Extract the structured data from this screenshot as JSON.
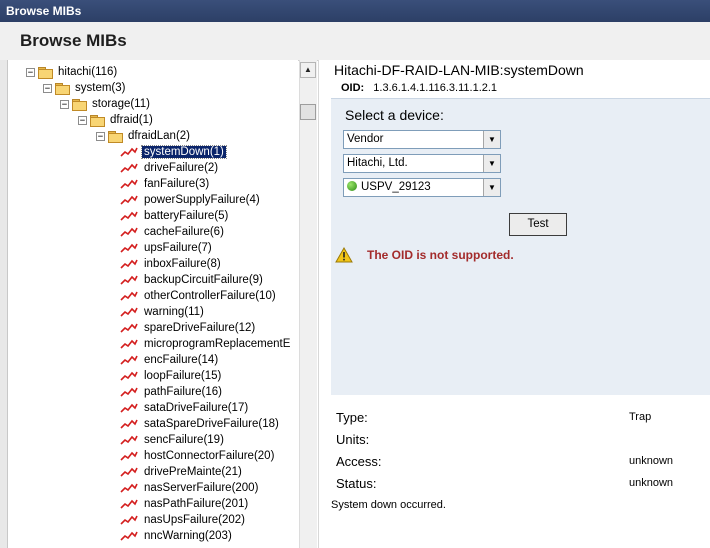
{
  "window": {
    "title": "Browse MIBs"
  },
  "header": {
    "title": "Browse MIBs"
  },
  "tree": {
    "nodes": [
      {
        "label": "hitachi(116)",
        "kind": "folder",
        "expander": "−"
      },
      {
        "label": "system(3)",
        "kind": "folder",
        "expander": "−"
      },
      {
        "label": "storage(11)",
        "kind": "folder",
        "expander": "−"
      },
      {
        "label": "dfraid(1)",
        "kind": "folder",
        "expander": "−"
      },
      {
        "label": "dfraidLan(2)",
        "kind": "folder",
        "expander": "−"
      },
      {
        "label": "systemDown(1)",
        "kind": "trap",
        "selected": true
      },
      {
        "label": "driveFailure(2)",
        "kind": "trap"
      },
      {
        "label": "fanFailure(3)",
        "kind": "trap"
      },
      {
        "label": "powerSupplyFailure(4)",
        "kind": "trap"
      },
      {
        "label": "batteryFailure(5)",
        "kind": "trap"
      },
      {
        "label": "cacheFailure(6)",
        "kind": "trap"
      },
      {
        "label": "upsFailure(7)",
        "kind": "trap"
      },
      {
        "label": "inboxFailure(8)",
        "kind": "trap"
      },
      {
        "label": "backupCircuitFailure(9)",
        "kind": "trap"
      },
      {
        "label": "otherControllerFailure(10)",
        "kind": "trap"
      },
      {
        "label": "warning(11)",
        "kind": "trap"
      },
      {
        "label": "spareDriveFailure(12)",
        "kind": "trap"
      },
      {
        "label": "microprogramReplacementE",
        "kind": "trap"
      },
      {
        "label": "encFailure(14)",
        "kind": "trap"
      },
      {
        "label": "loopFailure(15)",
        "kind": "trap"
      },
      {
        "label": "pathFailure(16)",
        "kind": "trap"
      },
      {
        "label": "sataDriveFailure(17)",
        "kind": "trap"
      },
      {
        "label": "sataSpareDriveFailure(18)",
        "kind": "trap"
      },
      {
        "label": "sencFailure(19)",
        "kind": "trap"
      },
      {
        "label": "hostConnectorFailure(20)",
        "kind": "trap"
      },
      {
        "label": "drivePreMainte(21)",
        "kind": "trap"
      },
      {
        "label": "nasServerFailure(200)",
        "kind": "trap"
      },
      {
        "label": "nasPathFailure(201)",
        "kind": "trap"
      },
      {
        "label": "nasUpsFailure(202)",
        "kind": "trap"
      },
      {
        "label": "nncWarning(203)",
        "kind": "trap"
      }
    ]
  },
  "detail": {
    "mib_name": "Hitachi-DF-RAID-LAN-MIB:systemDown",
    "oid_label": "OID:",
    "oid_value": "1.3.6.1.4.1.116.3.11.1.2.1",
    "select_title": "Select a device:",
    "device_type": "Vendor",
    "vendor": "Hitachi, Ltd.",
    "device": "USPV_29123",
    "device_status_color": "#3aa81c",
    "test_label": "Test",
    "warning": "The OID is not supported.",
    "warning_color": "#a32b2b"
  },
  "properties": {
    "type_label": "Type:",
    "type_value": "Trap",
    "units_label": "Units:",
    "access_label": "Access:",
    "access_value": "unknown",
    "status_label": "Status:",
    "status_value": "unknown",
    "description": "System down occurred."
  },
  "icons": {
    "folder": "folder-icon",
    "trap": "trap-icon",
    "warning": "warning-icon"
  },
  "colors": {
    "selection": "#0a246a",
    "panel_bg": "#e8eef5",
    "titlebar": "#2c3f66"
  }
}
